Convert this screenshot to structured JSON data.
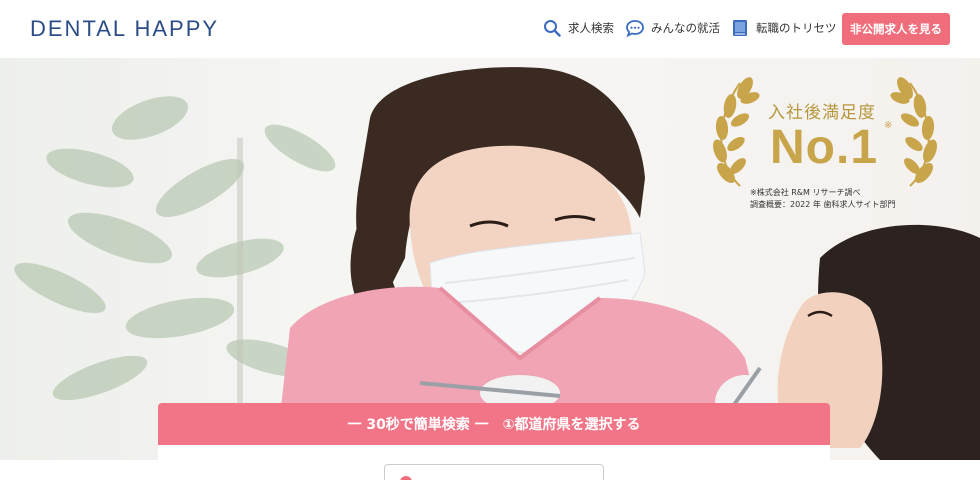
{
  "header": {
    "logo": "DENTAL HAPPY",
    "nav": [
      {
        "label": "求人検索",
        "icon": "search-icon"
      },
      {
        "label": "みんなの就活",
        "icon": "chat-bubble-icon"
      },
      {
        "label": "転職のトリセツ",
        "icon": "book-icon"
      }
    ],
    "cta_label": "非公開求人を見る"
  },
  "award": {
    "subtitle": "入社後満足度",
    "title": "No.1",
    "mark": "※",
    "note1": "※株式会社 R&M リサーチ調べ",
    "note2": "調査概要：2022 年 歯科求人サイト部門"
  },
  "search": {
    "heading": "一 30秒で簡単検索 一　①都道府県を選択する"
  },
  "colors": {
    "brand": "#2b4c86",
    "accent": "#f06e7c",
    "gold": "#c8a44a"
  }
}
